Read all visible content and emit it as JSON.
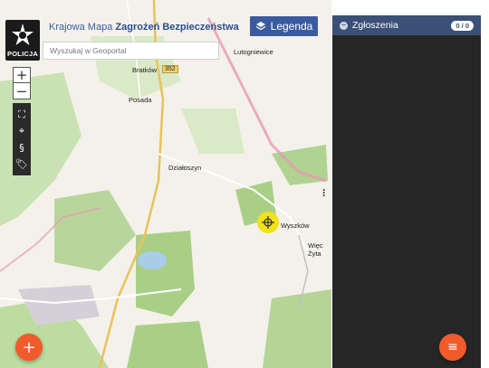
{
  "logo": {
    "text": "POLICJA",
    "icon": "police-star-icon"
  },
  "header": {
    "title_prefix": "Krajowa Mapa",
    "title_main": "Zagrożeń Bezpieczeństwa"
  },
  "legend_button": {
    "label": "Legenda",
    "icon": "layers-icon"
  },
  "search": {
    "placeholder": "Wyszukaj w Geoportal",
    "value": ""
  },
  "zoom": {
    "in_label": "+",
    "out_label": "−"
  },
  "tools": [
    {
      "name": "fullscreen-icon",
      "glyph": "⛶"
    },
    {
      "name": "locate-icon",
      "glyph": "⌖"
    },
    {
      "name": "paragraph-icon",
      "glyph": "§"
    },
    {
      "name": "tags-icon",
      "glyph": "🏷"
    }
  ],
  "map": {
    "places": [
      "Bratków",
      "Lutogniewice",
      "Posada",
      "Działoszyn",
      "Wyszków",
      "Więc",
      "Żyta"
    ],
    "road_number": "352",
    "colors": {
      "forest": "#a9cf87",
      "water": "#a9cde8",
      "border": "#e79ab4",
      "road": "#f1d36b",
      "marker": "#f2e21a"
    }
  },
  "panel": {
    "title": "Zgłoszenia",
    "count": "0 / 0"
  },
  "fab_add": {
    "label": "+"
  },
  "fab_filter": {
    "label": "≡"
  },
  "accent": "#f15a2b"
}
